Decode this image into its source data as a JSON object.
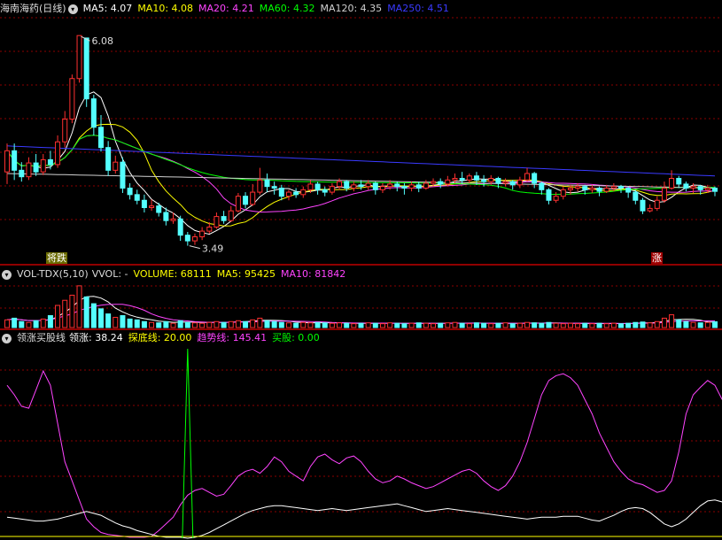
{
  "main": {
    "stock_name": "海南海药(日线)",
    "ma_labels": [
      {
        "text": "MA5: 4.07",
        "color": "#ffffff"
      },
      {
        "text": "MA10: 4.08",
        "color": "#ffff00"
      },
      {
        "text": "MA20: 4.21",
        "color": "#ff44ff"
      },
      {
        "text": "MA60: 4.32",
        "color": "#00ff00"
      },
      {
        "text": "MA120: 4.35",
        "color": "#d0d0d0"
      },
      {
        "text": "MA250: 4.51",
        "color": "#3a3aff"
      }
    ],
    "high_label": "6.08",
    "low_label": "3.49",
    "signal_left": "将跌",
    "signal_right": "涨"
  },
  "volume": {
    "title": "VOL-TDX(5,10)",
    "vvol": "VVOL: -",
    "labels": [
      {
        "text": "VOLUME: 68111",
        "color": "#ffff00"
      },
      {
        "text": "MA5: 95425",
        "color": "#ffff00"
      },
      {
        "text": "MA10: 81842",
        "color": "#ff44ff"
      }
    ]
  },
  "indicator": {
    "title": "领涨买股线",
    "labels": [
      {
        "text": "领涨: 38.24",
        "color": "#ffffff"
      },
      {
        "text": "探底线: 20.00",
        "color": "#ffff00"
      },
      {
        "text": "趋势线: 145.41",
        "color": "#ff44ff"
      },
      {
        "text": "买股: 0.00",
        "color": "#00ff00"
      }
    ]
  },
  "colors": {
    "up": "#ff3030",
    "down": "#54ffff",
    "grid": "#8b0000",
    "sep": "#c00000"
  },
  "chart_data": {
    "type": "candlestick",
    "price_range": [
      3.3,
      6.3
    ],
    "candles": [
      [
        4.4,
        4.66,
        4.75,
        4.25
      ],
      [
        4.66,
        4.42,
        4.75,
        4.3
      ],
      [
        4.42,
        4.34,
        4.52,
        4.28
      ],
      [
        4.34,
        4.51,
        4.58,
        4.3
      ],
      [
        4.51,
        4.4,
        4.62,
        4.35
      ],
      [
        4.4,
        4.55,
        4.62,
        4.36
      ],
      [
        4.55,
        4.49,
        4.66,
        4.43
      ],
      [
        4.49,
        4.77,
        4.85,
        4.45
      ],
      [
        4.77,
        5.05,
        5.15,
        4.7
      ],
      [
        5.05,
        5.55,
        5.6,
        5.0
      ],
      [
        5.55,
        6.08,
        6.08,
        5.5
      ],
      [
        6.05,
        5.3,
        6.05,
        5.2
      ],
      [
        5.3,
        4.95,
        5.35,
        4.85
      ],
      [
        4.95,
        4.7,
        5.1,
        4.65
      ],
      [
        4.7,
        4.42,
        4.78,
        4.35
      ],
      [
        4.42,
        4.52,
        4.6,
        4.38
      ],
      [
        4.52,
        4.2,
        4.58,
        4.14
      ],
      [
        4.2,
        4.12,
        4.26,
        4.06
      ],
      [
        4.12,
        4.05,
        4.18,
        4.0
      ],
      [
        4.05,
        3.96,
        4.12,
        3.9
      ],
      [
        3.96,
        3.98,
        4.06,
        3.92
      ],
      [
        3.98,
        3.9,
        4.02,
        3.85
      ],
      [
        3.9,
        3.8,
        3.96,
        3.74
      ],
      [
        3.8,
        3.82,
        3.9,
        3.76
      ],
      [
        3.82,
        3.62,
        3.86,
        3.55
      ],
      [
        3.62,
        3.55,
        3.66,
        3.49
      ],
      [
        3.55,
        3.6,
        3.64,
        3.5
      ],
      [
        3.6,
        3.67,
        3.72,
        3.56
      ],
      [
        3.67,
        3.72,
        3.78,
        3.64
      ],
      [
        3.72,
        3.85,
        3.9,
        3.7
      ],
      [
        3.85,
        3.8,
        3.92,
        3.76
      ],
      [
        3.8,
        3.92,
        3.98,
        3.78
      ],
      [
        3.92,
        4.1,
        4.14,
        3.9
      ],
      [
        4.1,
        4.0,
        4.15,
        3.95
      ],
      [
        4.0,
        4.15,
        4.25,
        3.98
      ],
      [
        4.15,
        4.3,
        4.45,
        4.12
      ],
      [
        4.3,
        4.22,
        4.38,
        4.15
      ],
      [
        4.22,
        4.2,
        4.28,
        4.12
      ],
      [
        4.2,
        4.1,
        4.24,
        4.05
      ],
      [
        4.1,
        4.15,
        4.18,
        4.05
      ],
      [
        4.15,
        4.12,
        4.2,
        4.08
      ],
      [
        4.12,
        4.18,
        4.22,
        4.08
      ],
      [
        4.18,
        4.25,
        4.3,
        4.14
      ],
      [
        4.25,
        4.18,
        4.28,
        4.12
      ],
      [
        4.18,
        4.15,
        4.22,
        4.1
      ],
      [
        4.15,
        4.22,
        4.26,
        4.12
      ],
      [
        4.22,
        4.28,
        4.32,
        4.18
      ],
      [
        4.28,
        4.2,
        4.3,
        4.16
      ],
      [
        4.2,
        4.24,
        4.28,
        4.16
      ],
      [
        4.24,
        4.22,
        4.3,
        4.18
      ],
      [
        4.22,
        4.26,
        4.3,
        4.18
      ],
      [
        4.26,
        4.18,
        4.28,
        4.12
      ],
      [
        4.18,
        4.22,
        4.26,
        4.14
      ],
      [
        4.22,
        4.25,
        4.3,
        4.18
      ],
      [
        4.25,
        4.22,
        4.28,
        4.16
      ],
      [
        4.22,
        4.2,
        4.26,
        4.12
      ],
      [
        4.2,
        4.24,
        4.28,
        4.16
      ],
      [
        4.24,
        4.2,
        4.28,
        4.15
      ],
      [
        4.2,
        4.26,
        4.3,
        4.18
      ],
      [
        4.26,
        4.28,
        4.32,
        4.22
      ],
      [
        4.28,
        4.25,
        4.32,
        4.2
      ],
      [
        4.25,
        4.3,
        4.35,
        4.22
      ],
      [
        4.3,
        4.32,
        4.38,
        4.26
      ],
      [
        4.32,
        4.3,
        4.4,
        4.25
      ],
      [
        4.3,
        4.35,
        4.38,
        4.26
      ],
      [
        4.35,
        4.3,
        4.4,
        4.24
      ],
      [
        4.3,
        4.28,
        4.36,
        4.22
      ],
      [
        4.28,
        4.32,
        4.36,
        4.24
      ],
      [
        4.32,
        4.26,
        4.34,
        4.2
      ],
      [
        4.26,
        4.28,
        4.32,
        4.22
      ],
      [
        4.28,
        4.24,
        4.3,
        4.18
      ],
      [
        4.24,
        4.3,
        4.34,
        4.2
      ],
      [
        4.3,
        4.38,
        4.45,
        4.28
      ],
      [
        4.38,
        4.26,
        4.4,
        4.2
      ],
      [
        4.26,
        4.18,
        4.28,
        4.12
      ],
      [
        4.18,
        4.05,
        4.2,
        4.0
      ],
      [
        4.05,
        4.1,
        4.15,
        4.02
      ],
      [
        4.1,
        4.18,
        4.22,
        4.06
      ],
      [
        4.18,
        4.2,
        4.24,
        4.12
      ],
      [
        4.2,
        4.22,
        4.26,
        4.16
      ],
      [
        4.22,
        4.18,
        4.24,
        4.12
      ],
      [
        4.18,
        4.2,
        4.24,
        4.14
      ],
      [
        4.2,
        4.16,
        4.22,
        4.1
      ],
      [
        4.16,
        4.2,
        4.24,
        4.14
      ],
      [
        4.2,
        4.22,
        4.26,
        4.16
      ],
      [
        4.22,
        4.2,
        4.24,
        4.14
      ],
      [
        4.2,
        4.15,
        4.22,
        4.08
      ],
      [
        4.15,
        4.05,
        4.18,
        4.0
      ],
      [
        4.05,
        3.92,
        4.08,
        3.88
      ],
      [
        3.92,
        3.95,
        4.0,
        3.9
      ],
      [
        3.95,
        4.05,
        4.1,
        3.92
      ],
      [
        4.05,
        4.2,
        4.28,
        4.02
      ],
      [
        4.2,
        4.32,
        4.42,
        4.18
      ],
      [
        4.32,
        4.25,
        4.35,
        4.2
      ],
      [
        4.25,
        4.2,
        4.28,
        4.16
      ],
      [
        4.2,
        4.22,
        4.26,
        4.14
      ],
      [
        4.22,
        4.18,
        4.24,
        4.12
      ],
      [
        4.18,
        4.2,
        4.24,
        4.14
      ],
      [
        4.2,
        4.16,
        4.22,
        4.1
      ]
    ],
    "volume_range": [
      0,
      520000
    ],
    "volumes": [
      90000,
      110000,
      70000,
      60000,
      80000,
      100000,
      140000,
      260000,
      320000,
      380000,
      490000,
      360000,
      280000,
      220000,
      160000,
      120000,
      140000,
      100000,
      90000,
      70000,
      60000,
      55000,
      70000,
      50000,
      80000,
      60000,
      55000,
      50000,
      60000,
      70000,
      60000,
      70000,
      80000,
      70000,
      90000,
      110000,
      80000,
      70000,
      60000,
      55000,
      50000,
      60000,
      55000,
      60000,
      55000,
      50000,
      55000,
      50000,
      45000,
      50000,
      55000,
      50000,
      45000,
      55000,
      50000,
      45000,
      50000,
      55000,
      50000,
      45000,
      50000,
      55000,
      60000,
      50000,
      45000,
      55000,
      50000,
      45000,
      50000,
      55000,
      45000,
      50000,
      60000,
      55000,
      50000,
      60000,
      50000,
      45000,
      50000,
      45000,
      50000,
      45000,
      50000,
      45000,
      50000,
      45000,
      50000,
      60000,
      65000,
      55000,
      70000,
      110000,
      150000,
      90000,
      70000,
      60000,
      55000,
      60000,
      68111
    ],
    "indicator_range": [
      0,
      200
    ],
    "lingzhang": [
      22,
      21,
      20,
      19,
      18,
      18,
      19,
      20,
      22,
      24,
      26,
      28,
      26,
      24,
      20,
      16,
      13,
      11,
      8,
      6,
      4,
      2,
      1,
      1,
      1,
      0,
      1,
      3,
      6,
      10,
      14,
      18,
      22,
      26,
      29,
      31,
      33,
      34,
      34,
      33,
      32,
      31,
      30,
      29,
      30,
      31,
      30,
      29,
      30,
      31,
      32,
      33,
      34,
      35,
      36,
      34,
      32,
      30,
      28,
      29,
      30,
      31,
      30,
      29,
      28,
      27,
      26,
      25,
      24,
      23,
      22,
      21,
      20,
      21,
      22,
      22,
      22,
      23,
      23,
      23,
      21,
      19,
      18,
      21,
      24,
      28,
      31,
      32,
      31,
      27,
      21,
      15,
      12,
      15,
      20,
      27,
      34,
      39,
      40,
      38
    ]
  }
}
